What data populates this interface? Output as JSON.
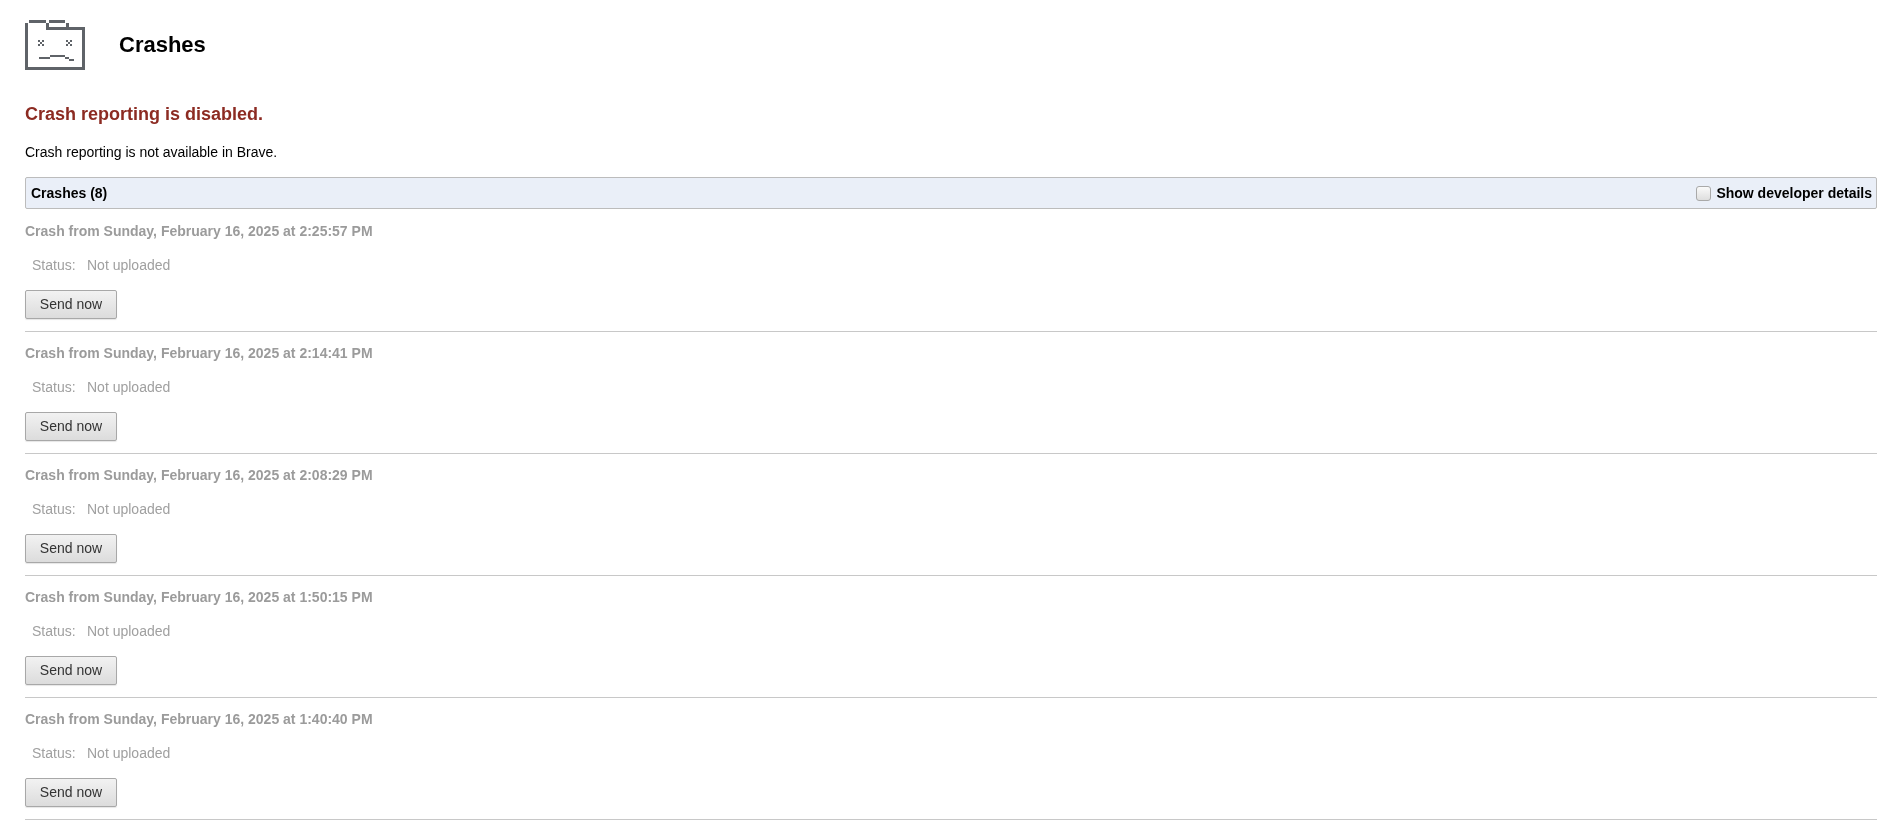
{
  "header": {
    "title": "Crashes"
  },
  "notice": {
    "heading": "Crash reporting is disabled.",
    "message": "Crash reporting is not available in Brave."
  },
  "crash_list": {
    "title": "Crashes (8)",
    "developer_details": {
      "label": "Show developer details",
      "checked": false
    },
    "crashes": [
      {
        "title": "Crash from Sunday, February 16, 2025 at 2:25:57 PM",
        "status_label": "Status:",
        "status": "Not uploaded",
        "button": "Send now"
      },
      {
        "title": "Crash from Sunday, February 16, 2025 at 2:14:41 PM",
        "status_label": "Status:",
        "status": "Not uploaded",
        "button": "Send now"
      },
      {
        "title": "Crash from Sunday, February 16, 2025 at 2:08:29 PM",
        "status_label": "Status:",
        "status": "Not uploaded",
        "button": "Send now"
      },
      {
        "title": "Crash from Sunday, February 16, 2025 at 1:50:15 PM",
        "status_label": "Status:",
        "status": "Not uploaded",
        "button": "Send now"
      },
      {
        "title": "Crash from Sunday, February 16, 2025 at 1:40:40 PM",
        "status_label": "Status:",
        "status": "Not uploaded",
        "button": "Send now"
      }
    ]
  }
}
